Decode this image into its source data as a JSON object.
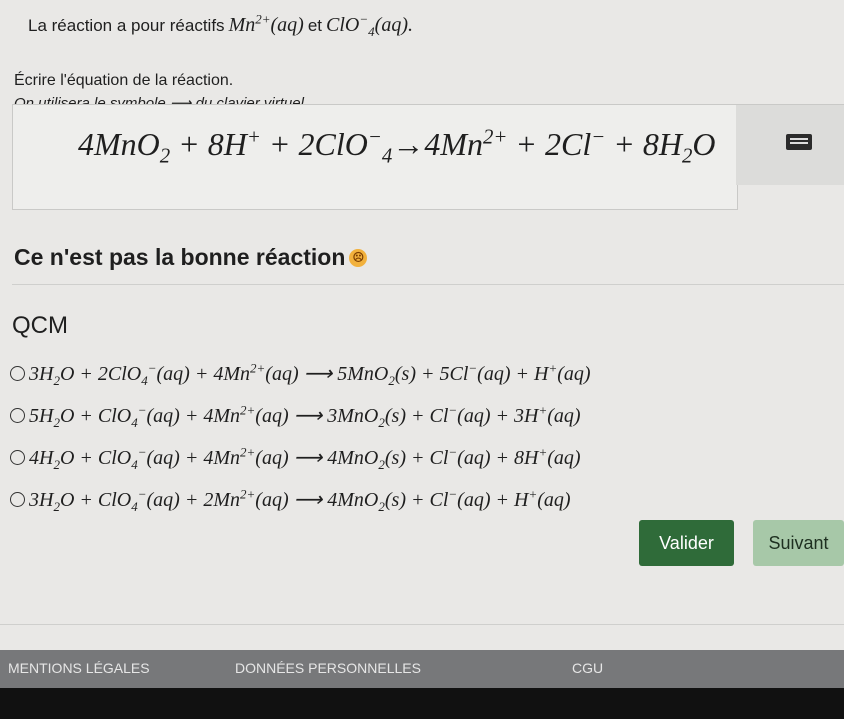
{
  "intro": {
    "text": "La réaction a pour réactifs",
    "reactant1": "Mn",
    "reactant1_sup": "2+",
    "reactant1_state": "(aq)",
    "conj": "et",
    "reactant2": "ClO",
    "reactant2_sup": "−",
    "reactant2_sub": "4",
    "reactant2_state": "(aq)."
  },
  "instruction": "Écrire l'équation de la réaction.",
  "hint": "On utilisera le symbole ⟶ du clavier virtuel.",
  "answer": {
    "c1": "4MnO",
    "c1_sub": "2",
    "plus1": " + 8H",
    "c2_sup": "+",
    "plus2": " + 2ClO",
    "c3_sup": "−",
    "c3_sub": "4",
    "arrow": "→",
    "p1": "4Mn",
    "p1_sup": "2+",
    "plus3": " + 2Cl",
    "p2_sup": "−",
    "plus4": " + 8H",
    "p3_sub": "2",
    "p3_end": "O"
  },
  "keyboard_icon": "keyboard-icon",
  "feedback": "Ce n'est pas la bonne réaction",
  "feedback_emoji": "sad-face-icon",
  "qcm_title": "QCM",
  "options": [
    {
      "a": "3H",
      "a_sub": "2",
      "b": "O + 2ClO",
      "b_sub": "4",
      "b_sup": "−",
      "c": "(aq) + 4Mn",
      "c_sup": "2+",
      "d": "(aq) ⟶ 5MnO",
      "d_sub": "2",
      "e": "(s) + 5Cl",
      "e_sup": "−",
      "f": "(aq) + H",
      "f_sup": "+",
      "g": "(aq)"
    },
    {
      "a": "5H",
      "a_sub": "2",
      "b": "O + ClO",
      "b_sub": "4",
      "b_sup": "−",
      "c": "(aq) + 4Mn",
      "c_sup": "2+",
      "d": "(aq) ⟶ 3MnO",
      "d_sub": "2",
      "e": "(s) + Cl",
      "e_sup": "−",
      "f": "(aq) + 3H",
      "f_sup": "+",
      "g": "(aq)"
    },
    {
      "a": "4H",
      "a_sub": "2",
      "b": "O + ClO",
      "b_sub": "4",
      "b_sup": "−",
      "c": "(aq) + 4Mn",
      "c_sup": "2+",
      "d": "(aq) ⟶ 4MnO",
      "d_sub": "2",
      "e": "(s) + Cl",
      "e_sup": "−",
      "f": "(aq) + 8H",
      "f_sup": "+",
      "g": "(aq)"
    },
    {
      "a": "3H",
      "a_sub": "2",
      "b": "O + ClO",
      "b_sub": "4",
      "b_sup": "−",
      "c": "(aq) + 2Mn",
      "c_sup": "2+",
      "d": "(aq) ⟶ 4MnO",
      "d_sub": "2",
      "e": "(s) + Cl",
      "e_sup": "−",
      "f": "(aq) + H",
      "f_sup": "+",
      "g": "(aq)"
    }
  ],
  "buttons": {
    "valider": "Valider",
    "suivant": "Suivant"
  },
  "footer": {
    "legal": "MENTIONS LÉGALES",
    "data": "DONNÉES PERSONNELLES",
    "cgu": "CGU"
  },
  "colors": {
    "valider_bg": "#2f6b39",
    "suivant_bg": "#a7c8a8"
  }
}
